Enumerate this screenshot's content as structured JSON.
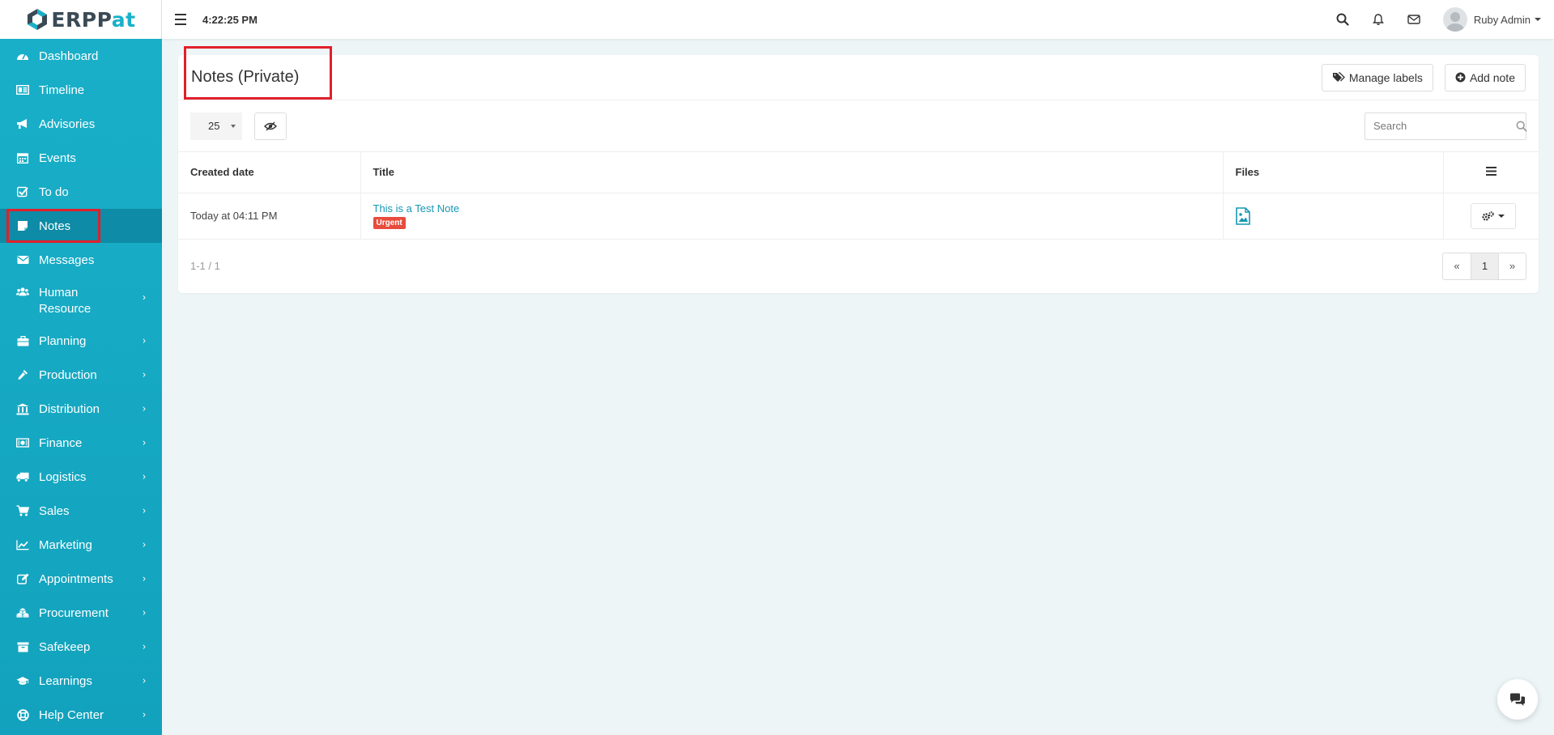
{
  "app": {
    "brand_left": "ERP",
    "brand_right": "at",
    "brand_p": "P"
  },
  "topbar": {
    "clock": "4:22:25 PM",
    "user_name": "Ruby Admin"
  },
  "sidebar": {
    "items": [
      {
        "label": "Dashboard",
        "icon": "dashboard-icon"
      },
      {
        "label": "Timeline",
        "icon": "timeline-icon"
      },
      {
        "label": "Advisories",
        "icon": "bullhorn-icon"
      },
      {
        "label": "Events",
        "icon": "calendar-icon"
      },
      {
        "label": "To do",
        "icon": "check-square-icon"
      },
      {
        "label": "Notes",
        "icon": "sticky-note-icon"
      },
      {
        "label": "Messages",
        "icon": "envelope-icon"
      },
      {
        "label": "Human Resource",
        "icon": "users-icon"
      },
      {
        "label": "Planning",
        "icon": "briefcase-icon"
      },
      {
        "label": "Production",
        "icon": "eyedropper-icon"
      },
      {
        "label": "Distribution",
        "icon": "bank-icon"
      },
      {
        "label": "Finance",
        "icon": "money-icon"
      },
      {
        "label": "Logistics",
        "icon": "truck-icon"
      },
      {
        "label": "Sales",
        "icon": "cart-icon"
      },
      {
        "label": "Marketing",
        "icon": "line-chart-icon"
      },
      {
        "label": "Appointments",
        "icon": "edit-icon"
      },
      {
        "label": "Procurement",
        "icon": "cubes-icon"
      },
      {
        "label": "Safekeep",
        "icon": "archive-icon"
      },
      {
        "label": "Learnings",
        "icon": "graduation-cap-icon"
      },
      {
        "label": "Help Center",
        "icon": "life-ring-icon"
      }
    ],
    "active": "Notes"
  },
  "main": {
    "title": "Notes (Private)",
    "manage_labels": "Manage labels",
    "add_note": "Add note",
    "page_size": "25",
    "search_placeholder": "Search",
    "table": {
      "headers": [
        "Created date",
        "Title",
        "Files"
      ],
      "rows": [
        {
          "created": "Today at 04:11 PM",
          "title": "This is a Test Note",
          "label": "Urgent"
        }
      ]
    },
    "info": "1-1 / 1",
    "pager": {
      "prev": "«",
      "current": "1",
      "next": "»"
    }
  },
  "colors": {
    "sidebar": "#1ab0c9",
    "sidebar_active": "#0e8ba6",
    "link": "#1797b4",
    "badge": "#e74c3c",
    "highlight": "#e0202a"
  }
}
